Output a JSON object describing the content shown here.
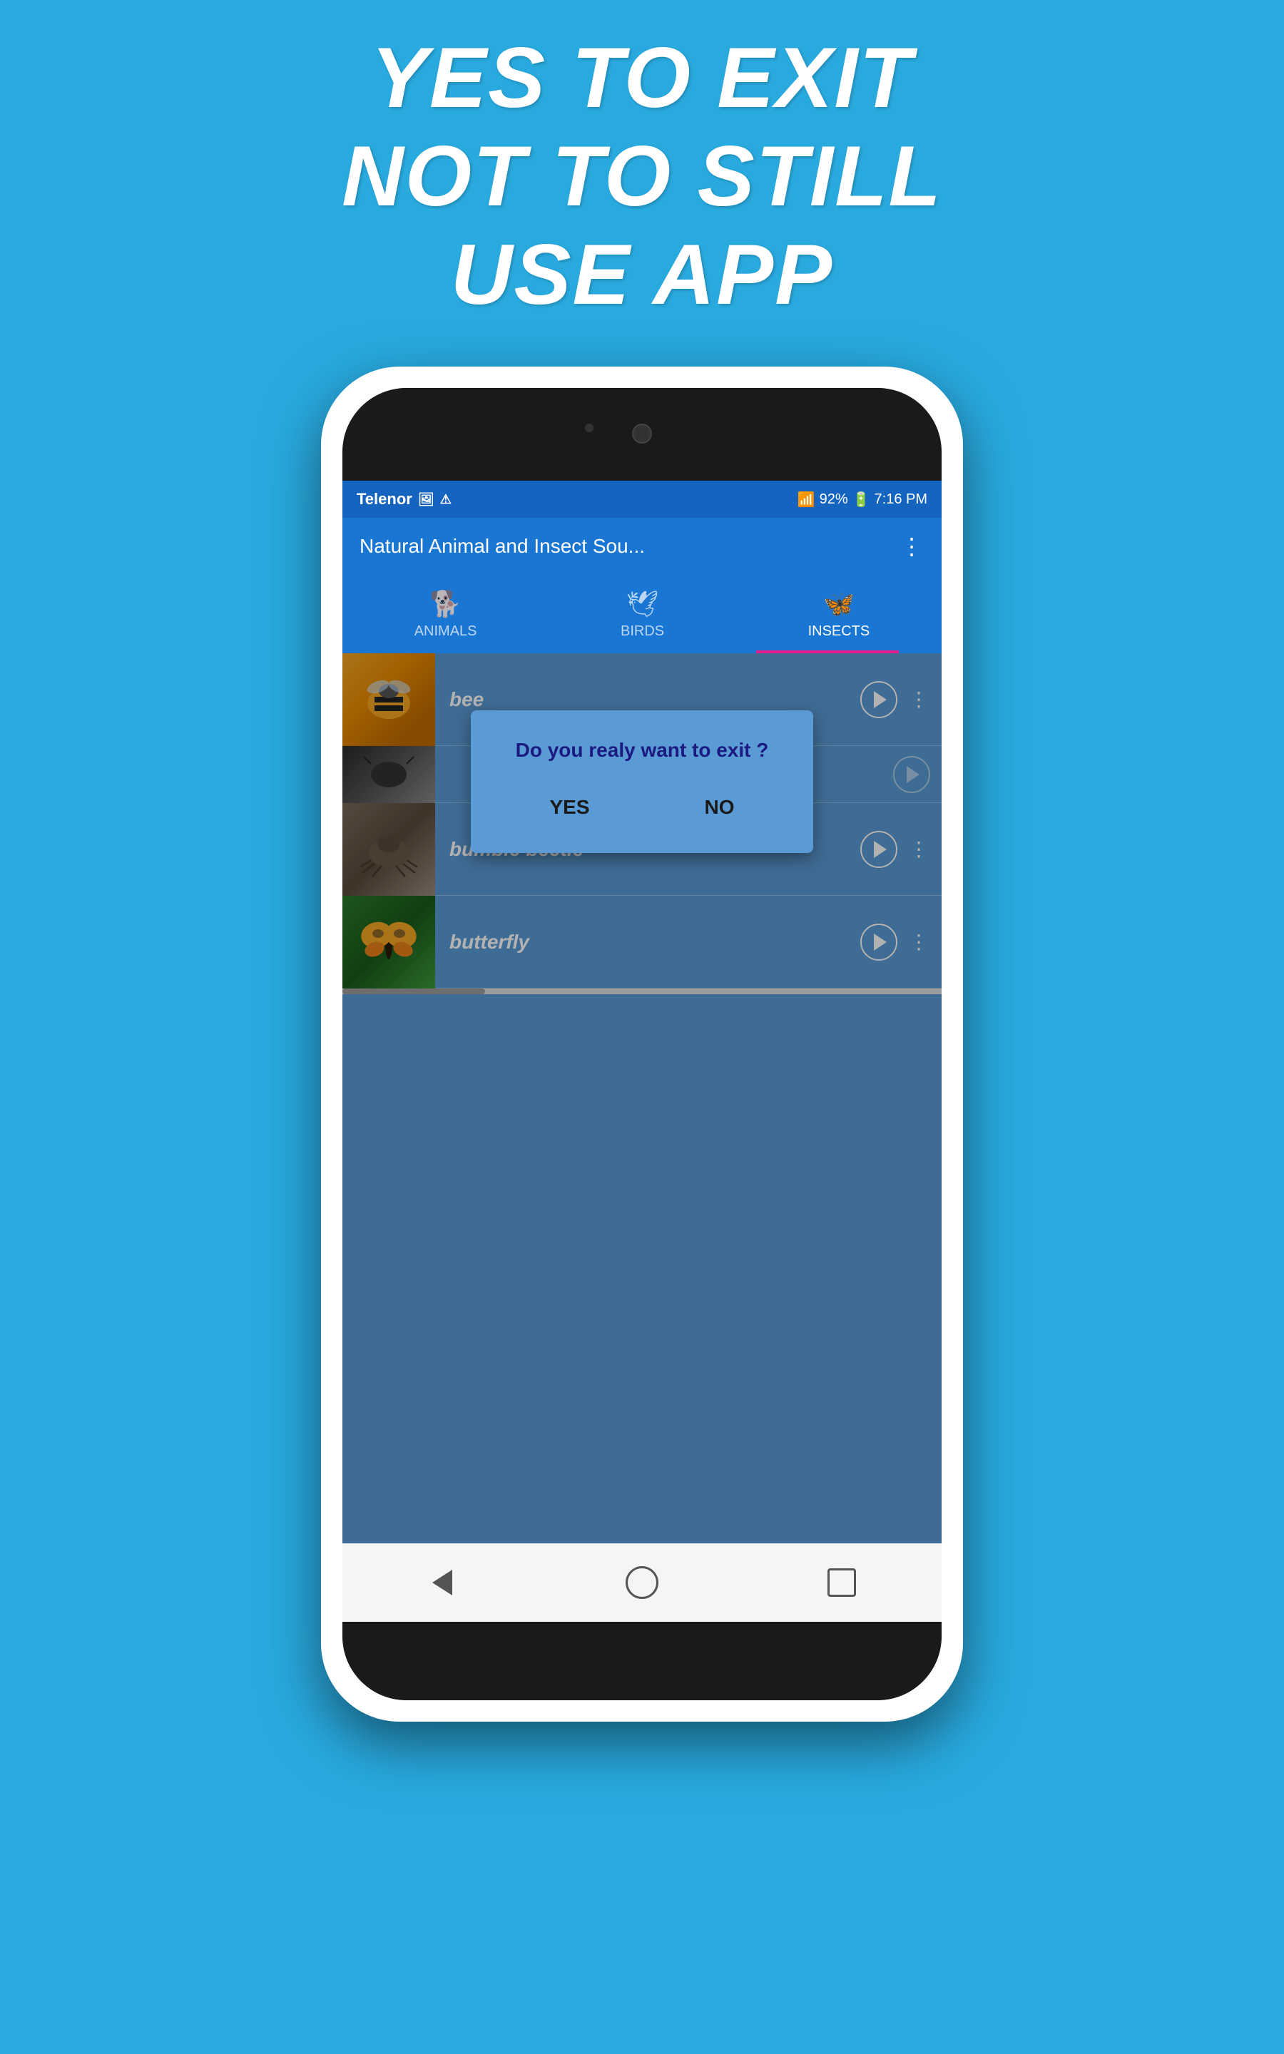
{
  "header": {
    "line1": "YES TO EXIT",
    "line2": "NOT TO STILL",
    "line3": "USE APP"
  },
  "status_bar": {
    "carrier": "Telenor",
    "battery": "92%",
    "time": "7:16 PM"
  },
  "app_bar": {
    "title": "Natural Animal and Insect Sou...",
    "menu_icon": "⋮"
  },
  "tabs": [
    {
      "label": "ANIMALS",
      "icon": "🐕",
      "active": false
    },
    {
      "label": "BIRDS",
      "icon": "🕊",
      "active": false
    },
    {
      "label": "INSECTS",
      "icon": "🦋",
      "active": true
    }
  ],
  "list_items": [
    {
      "id": "bee",
      "label": "bee",
      "thumb_type": "bee"
    },
    {
      "id": "bumble-bee",
      "label": "",
      "thumb_type": "bumble-bee"
    },
    {
      "id": "bumble-beetle",
      "label": "bumble beetle",
      "thumb_type": "bumble-beetle"
    },
    {
      "id": "butterfly",
      "label": "butterfly",
      "thumb_type": "butterfly"
    }
  ],
  "dialog": {
    "message": "Do you realy want to exit ?",
    "yes_label": "YES",
    "no_label": "NO"
  },
  "bottom_nav": {
    "back_label": "back",
    "home_label": "home",
    "recent_label": "recent"
  }
}
